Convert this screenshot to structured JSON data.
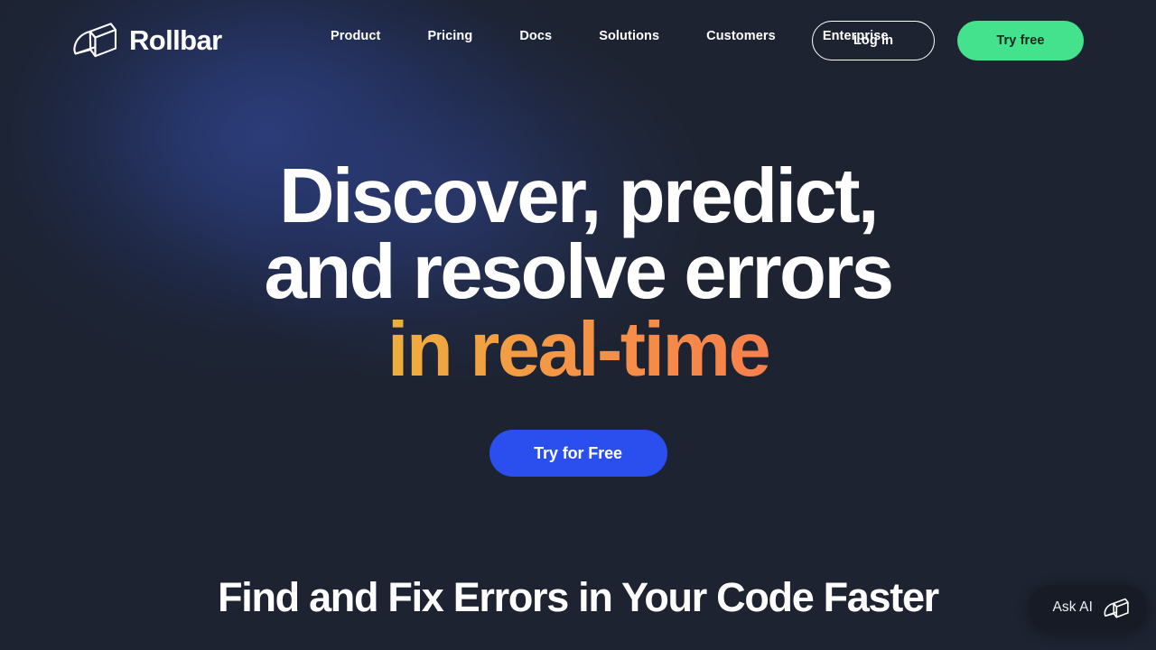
{
  "brand": {
    "name": "Rollbar",
    "logo_icon": "rollbar-cube-icon"
  },
  "nav": {
    "items": [
      {
        "label": "Product"
      },
      {
        "label": "Pricing"
      },
      {
        "label": "Docs"
      },
      {
        "label": "Solutions"
      },
      {
        "label": "Customers"
      },
      {
        "label": "Enterprise"
      }
    ]
  },
  "header_actions": {
    "login_label": "Log in",
    "try_free_label": "Try free",
    "try_free_color": "#45e28d"
  },
  "hero": {
    "headline_line1": "Discover, predict,",
    "headline_line2": "and resolve errors",
    "headline_line3_gradient": "in real-time",
    "gradient_start_color": "#e8ec2a",
    "gradient_end_color": "#f9704f",
    "cta_label": "Try for Free",
    "cta_color": "#2b4eee"
  },
  "section": {
    "title": "Find and Fix Errors in Your Code Faster"
  },
  "ask_ai": {
    "label": "Ask AI",
    "icon": "rollbar-cube-icon"
  },
  "theme": {
    "background": "#1d2330",
    "glow": "#2d3e7d",
    "text": "#ffffff"
  }
}
